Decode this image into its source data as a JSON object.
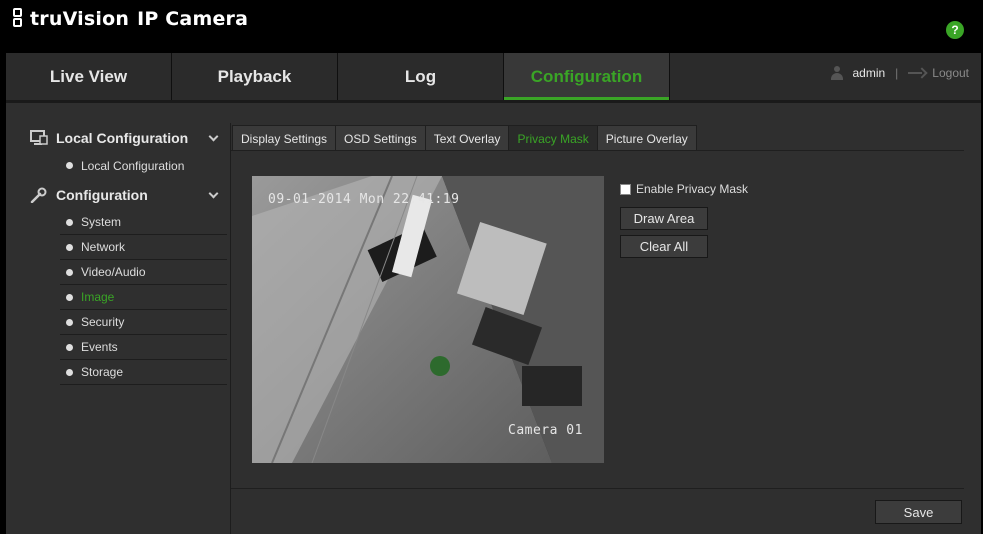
{
  "app": {
    "brand": "truVision",
    "product": "IP Camera",
    "help_label": "?"
  },
  "nav": {
    "tabs": [
      {
        "label": "Live View"
      },
      {
        "label": "Playback"
      },
      {
        "label": "Log"
      },
      {
        "label": "Configuration",
        "active": true
      }
    ],
    "user": "admin",
    "separator": "|",
    "logout": "Logout"
  },
  "sidebar": {
    "groups": [
      {
        "label": "Local Configuration",
        "icon": "monitor-icon",
        "items": [
          {
            "label": "Local Configuration"
          }
        ]
      },
      {
        "label": "Configuration",
        "icon": "wrench-icon",
        "items": [
          {
            "label": "System"
          },
          {
            "label": "Network"
          },
          {
            "label": "Video/Audio"
          },
          {
            "label": "Image",
            "active": true
          },
          {
            "label": "Security"
          },
          {
            "label": "Events"
          },
          {
            "label": "Storage"
          }
        ]
      }
    ]
  },
  "tabs": [
    {
      "label": "Display Settings"
    },
    {
      "label": "OSD Settings"
    },
    {
      "label": "Text Overlay"
    },
    {
      "label": "Privacy Mask",
      "active": true
    },
    {
      "label": "Picture Overlay"
    }
  ],
  "video": {
    "datetime_osd": "09-01-2014 Mon 22:41:19",
    "camera_name_osd": "Camera 01"
  },
  "privacy": {
    "enable_label": "Enable Privacy Mask",
    "enabled": false,
    "draw_area_label": "Draw Area",
    "clear_all_label": "Clear All"
  },
  "save_label": "Save",
  "colors": {
    "accent": "#3aa526",
    "background": "#2f2f2f",
    "nav": "#2b2b2b"
  }
}
